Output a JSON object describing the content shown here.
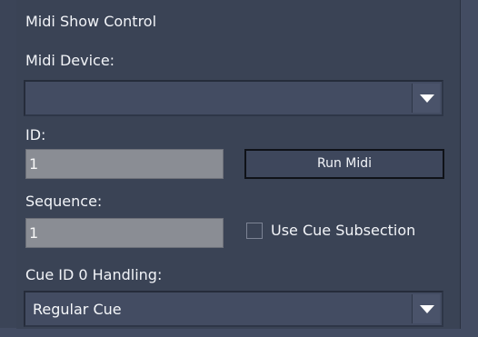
{
  "section_title": "Midi Show Control",
  "midi_device": {
    "label": "Midi Device:",
    "value": ""
  },
  "id": {
    "label": "ID:",
    "value": "1"
  },
  "run_midi_button": "Run Midi",
  "sequence": {
    "label": "Sequence:",
    "value": "1"
  },
  "use_cue_subsection": {
    "label": "Use Cue Subsection",
    "checked": false
  },
  "cue_id_handling": {
    "label": "Cue ID 0 Handling:",
    "value": "Regular Cue"
  },
  "icons": {
    "dropdown_arrow": "chevron-down-icon"
  },
  "colors": {
    "panel_background": "#3a4355",
    "field_background": "#8a8d94",
    "text": "#f2f4f8"
  }
}
